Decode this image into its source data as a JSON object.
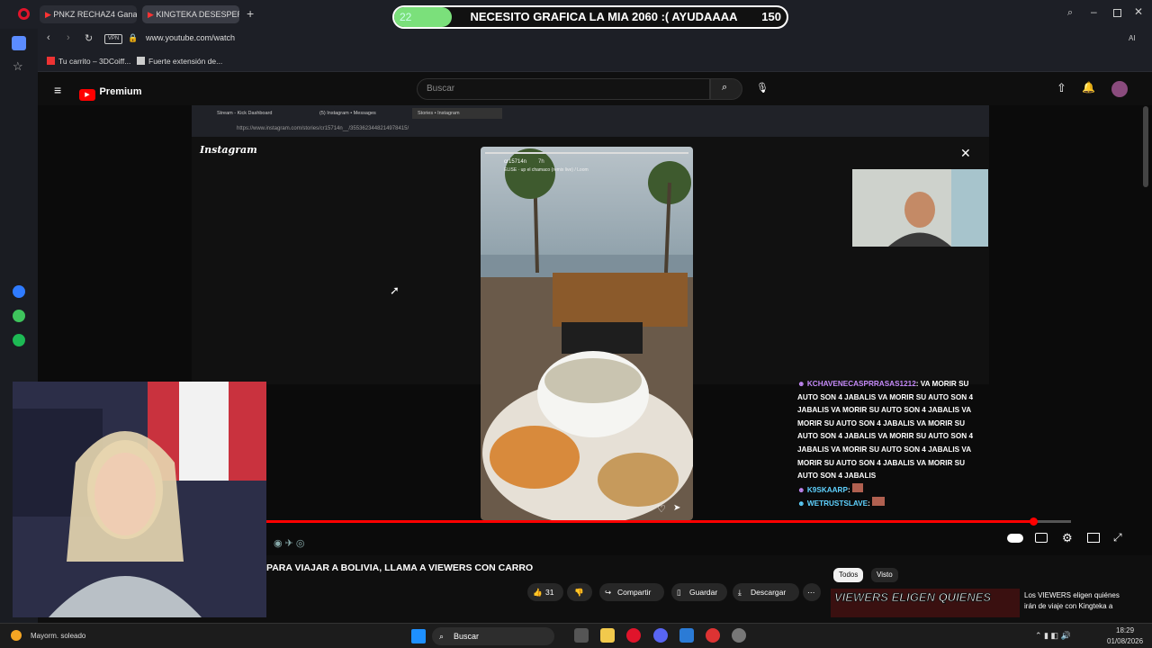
{
  "browser": {
    "tabs": [
      {
        "label": "PNKZ RECHAZ4 Gana"
      },
      {
        "label": "KINGTEKA DESESPER"
      }
    ],
    "address": "www.youtube.com/watch",
    "bookmarks": [
      {
        "label": "Tu carrito – 3DCoiff..."
      },
      {
        "label": "Fuerte extensión de..."
      }
    ],
    "ai_label": "AI"
  },
  "banner": {
    "left_value": "22",
    "text": "NECESITO GRAFICA LA MIA 2060 :( AYUDAAAA",
    "right_value": "150"
  },
  "youtube": {
    "logo": "Premium",
    "search_placeholder": "Buscar",
    "video_title": "PARA VIAJAR A BOLIVIA, LLAMA A VIEWERS CON CARRO",
    "likes": "31",
    "share": "Compartir",
    "save": "Guardar",
    "download": "Descargar",
    "chips": [
      "Todos",
      "Visto"
    ],
    "recommended_thumb_text": "VIEWERS ELIGEN QUIENES",
    "recommended_title": "Los VIEWERS eligen quiénes irán de viaje con Kingteka a"
  },
  "inner_window": {
    "tabs": [
      {
        "label": "Stream - Kick Dashboard"
      },
      {
        "label": "(5) Instagram • Messages"
      },
      {
        "label": "Stories • Instagram"
      }
    ],
    "address": "https://www.instagram.com/stories/cr15714n__/3553623448214978415/",
    "site_logo": "Instagram",
    "story_user": "cr15714n",
    "story_time": "7h",
    "story_audio": "ELISE · up el chamaco (remix live) / Loom"
  },
  "chat": [
    {
      "user": "KCHAVENECASPRRASAS1212",
      "text": "VA MORIR SU AUTO SON 4 JABALIS VA MORIR SU AUTO SON 4 JABALIS VA MORIR SU AUTO SON 4 JABALIS VA MORIR SU AUTO SON 4 JABALIS VA MORIR SU AUTO SON 4 JABALIS VA MORIR SU AUTO SON 4 JABALIS VA MORIR SU AUTO SON 4 JABALIS VA MORIR SU AUTO SON 4 JABALIS VA MORIR SU AUTO SON 4 JABALIS"
    },
    {
      "user": "k9skaarp",
      "text": ""
    },
    {
      "user": "WETRUSTSLAVE",
      "text": ""
    }
  ],
  "taskbar": {
    "weather": "Mayorm. soleado",
    "search": "Buscar",
    "time": "18:29",
    "date": "01/08/2026"
  },
  "colors": {
    "youtube_red": "#ff0000",
    "chat_user": "#c58af9",
    "chat_user2": "#5fd2ff",
    "banner_green": "#7be07b"
  }
}
